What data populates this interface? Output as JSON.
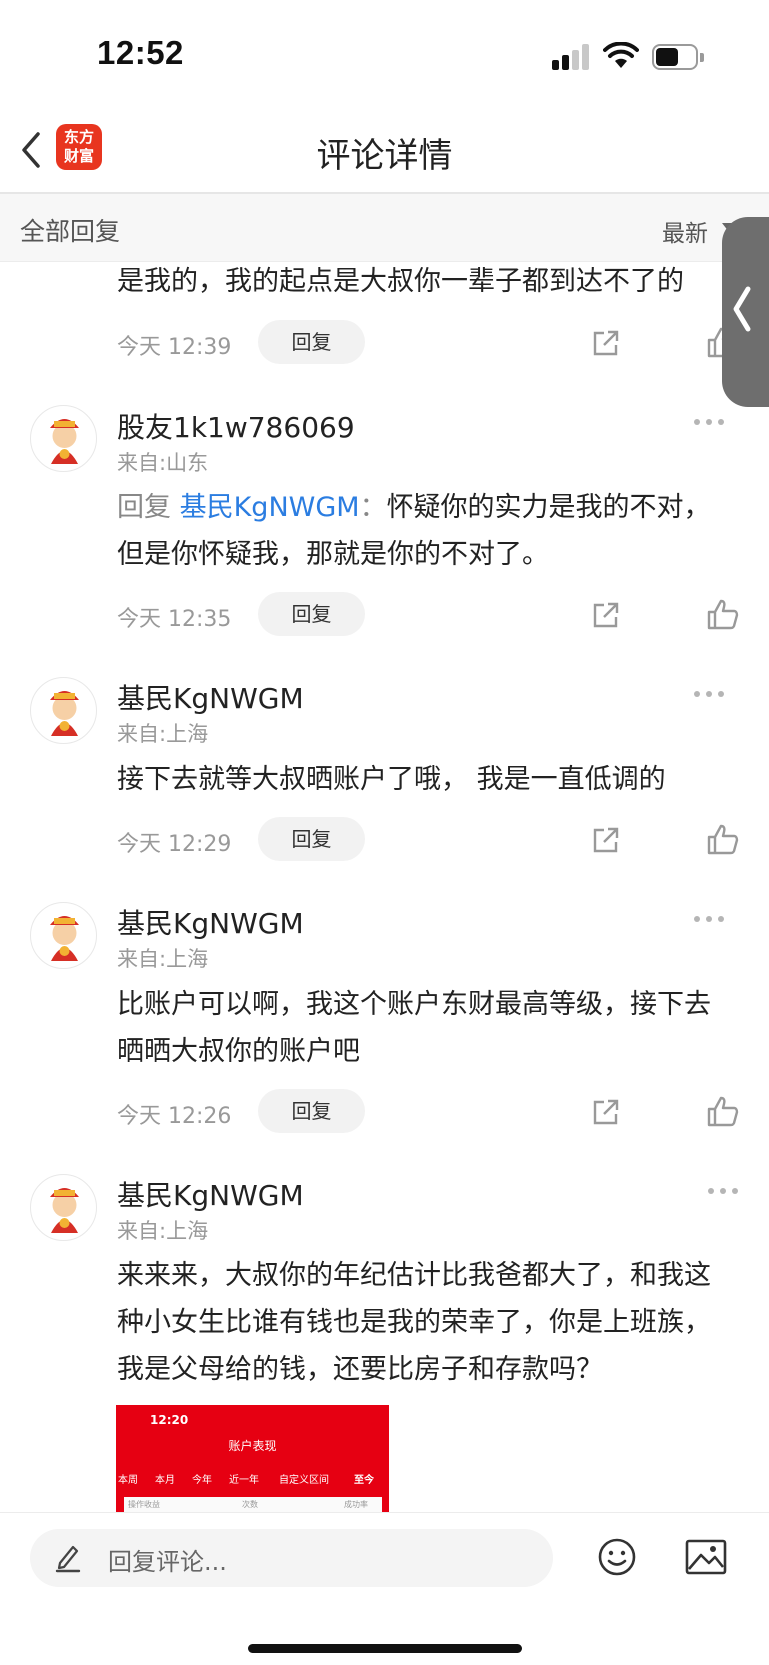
{
  "status_bar": {
    "time": "12:52"
  },
  "header": {
    "title": "评论详情",
    "logo_text": "东方\n财富"
  },
  "subheader": {
    "title": "全部回复",
    "sort_label": "最新"
  },
  "partial_comment": {
    "text": "是我的，我的起点是大叔你一辈子都到达不了的",
    "time": "今天 12:39",
    "reply_label": "回复"
  },
  "comments": [
    {
      "username": "股友1k1w786069",
      "location": "来自:山东",
      "reply_prefix": "回复 ",
      "mention": "基民KgNWGM",
      "reply_sep": "：",
      "text": "怀疑你的实力是我的不对，但是你怀疑我，那就是你的不对了。",
      "time": "今天 12:35",
      "reply_label": "回复"
    },
    {
      "username": "基民KgNWGM",
      "location": "来自:上海",
      "text": "接下去就等大叔晒账户了哦， 我是一直低调的",
      "time": "今天 12:29",
      "reply_label": "回复"
    },
    {
      "username": "基民KgNWGM",
      "location": "来自:上海",
      "text": "比账户可以啊，我这个账户东财最高等级，接下去晒晒大叔你的账户吧",
      "time": "今天 12:26",
      "reply_label": "回复"
    },
    {
      "username": "基民KgNWGM",
      "location": "来自:上海",
      "text": "来来来，大叔你的年纪估计比我爸都大了，和我这种小女生比谁有钱也是我的荣幸了，你是上班族，我是父母给的钱，还要比房子和存款吗？",
      "image": {
        "time": "12:20",
        "title": "账户表现",
        "tabs": [
          "本周",
          "本月",
          "今年",
          "近一年",
          "自定义区间",
          "至今"
        ],
        "strip_text": "操作收益",
        "strip_count": "次数",
        "strip_rate": "成功率"
      }
    }
  ],
  "bottom_bar": {
    "placeholder": "回复评论..."
  },
  "colors": {
    "accent": "#2b7de1",
    "brand": "#e8351f"
  }
}
